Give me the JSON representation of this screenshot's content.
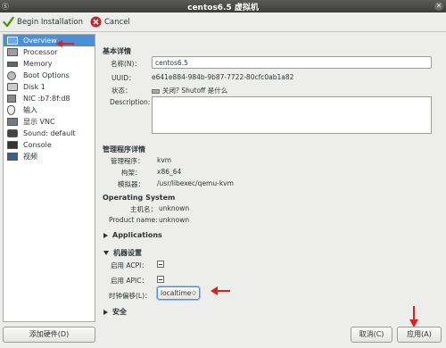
{
  "window": {
    "left_text": "Ⓢ",
    "title": "centos6.5 虚拟机",
    "close": "✕"
  },
  "toolbar": {
    "begin_label": "Begin Installation",
    "cancel_label": "Cancel"
  },
  "sidebar": {
    "items": [
      {
        "label": "Overview",
        "icon": "monitor-icon"
      },
      {
        "label": "Processor",
        "icon": "cpu-icon"
      },
      {
        "label": "Memory",
        "icon": "memory-icon"
      },
      {
        "label": "Boot Options",
        "icon": "boot-icon"
      },
      {
        "label": "Disk 1",
        "icon": "disk-icon"
      },
      {
        "label": "NIC :b7:8f:d8",
        "icon": "nic-icon"
      },
      {
        "label": "输入",
        "icon": "mouse-icon"
      },
      {
        "label": "显示 VNC",
        "icon": "display-icon"
      },
      {
        "label": "Sound: default",
        "icon": "sound-icon"
      },
      {
        "label": "Console",
        "icon": "console-icon"
      },
      {
        "label": "视频",
        "icon": "video-icon"
      }
    ],
    "add_hardware": "添加硬件(D)"
  },
  "basic": {
    "title": "基本详情",
    "name_label": "名称(N)：",
    "name_value": "centos6.5",
    "uuid_label": "UUID：",
    "uuid_value": "e641e884-984b-9b87-7722-80cfc0ab1a82",
    "state_label": "状态：",
    "state_value": "关闭? Shutoff 是什么",
    "desc_label": "Description:"
  },
  "hypervisor": {
    "title": "管理程序详情",
    "hv_label": "管理程序：",
    "hv_value": "kvm",
    "arch_label": "构架：",
    "arch_value": "x86_64",
    "emu_label": "模拟器：",
    "emu_value": "/usr/libexec/qemu-kvm"
  },
  "os": {
    "title": "Operating System",
    "host_label": "主机名：",
    "host_value": "unknown",
    "product_label": "Product name:",
    "product_value": "unknown"
  },
  "applications": {
    "label": "Applications"
  },
  "machine": {
    "title": "机器设置",
    "acpi_label": "启用 ACPI：",
    "apic_label": "启用 APIC：",
    "clock_label": "时钟偏移(L)：",
    "clock_value": "localtime",
    "clock_spin": "◇"
  },
  "security": {
    "label": "安全"
  },
  "buttons": {
    "cancel": "取消(C)",
    "apply": "应用(A)"
  },
  "colors": {
    "accent": "#4a90d9",
    "arrow": "#e02020"
  }
}
